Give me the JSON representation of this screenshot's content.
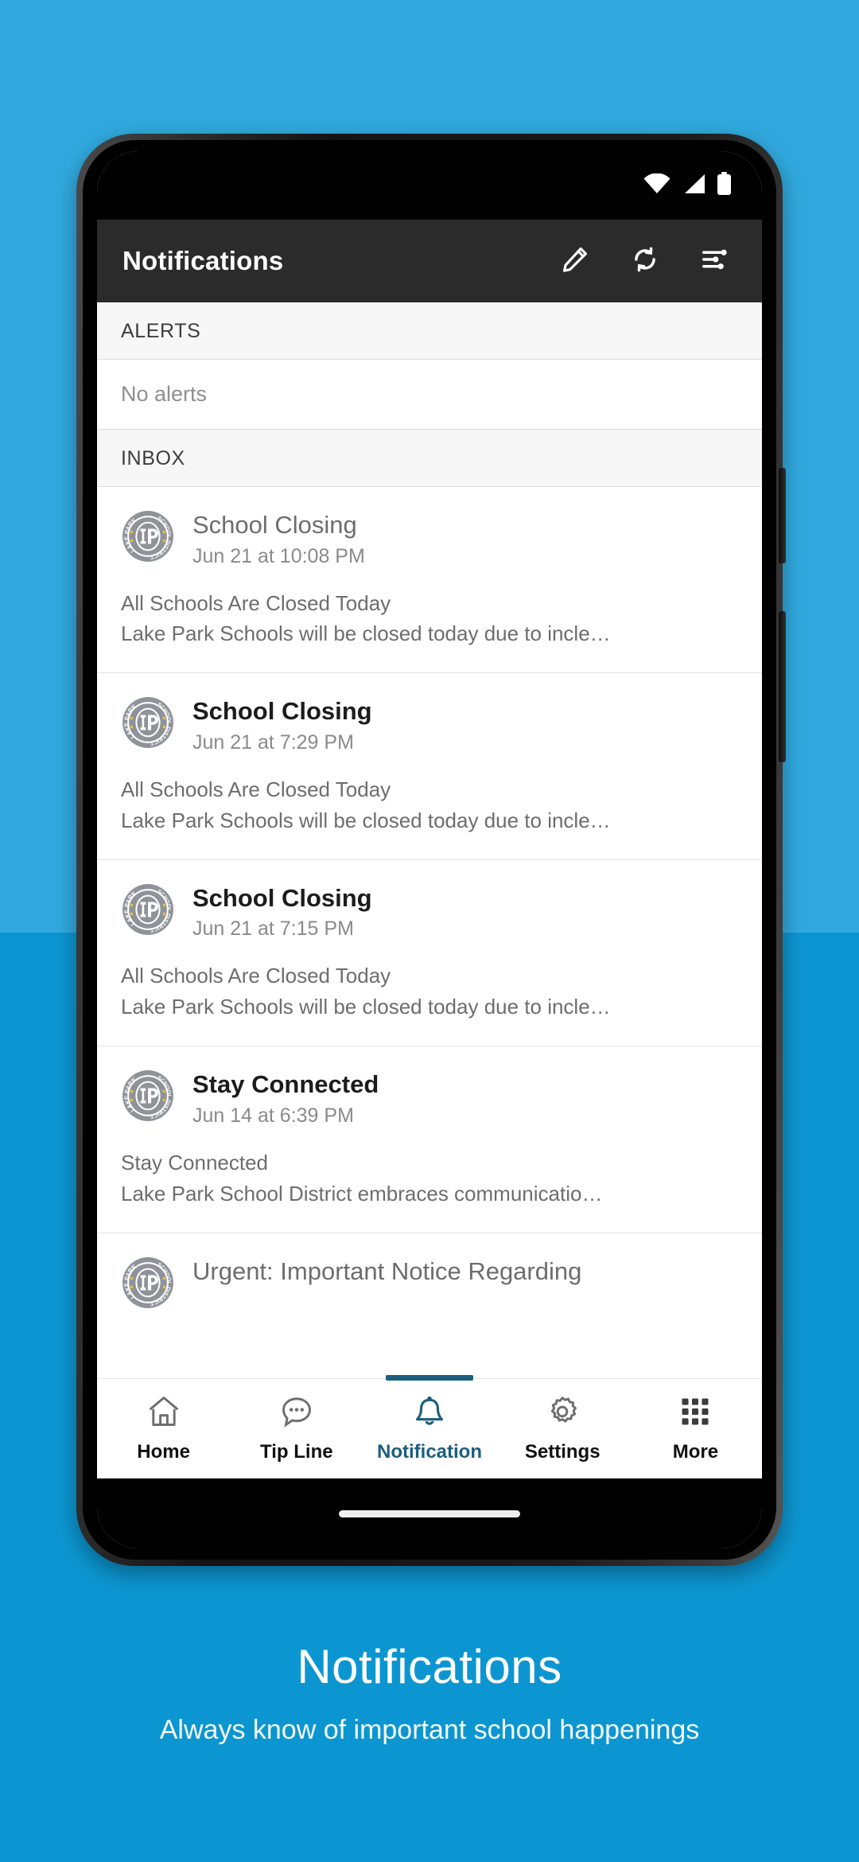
{
  "background": {
    "top_color": "#31a9de",
    "bottom_color": "#0c96d1"
  },
  "status_bar": {
    "icons": [
      "wifi-icon",
      "cellular-signal-icon",
      "battery-icon"
    ]
  },
  "app_bar": {
    "title": "Notifications",
    "actions": [
      {
        "name": "compose-button",
        "icon": "pencil-icon"
      },
      {
        "name": "refresh-button",
        "icon": "sync-icon"
      },
      {
        "name": "filter-button",
        "icon": "tune-sliders-icon"
      }
    ]
  },
  "sections": {
    "alerts_header": "ALERTS",
    "alerts_empty": "No alerts",
    "inbox_header": "INBOX"
  },
  "messages": [
    {
      "title": "School Closing",
      "date": "Jun 21 at 10:08 PM",
      "subject": "All Schools Are Closed Today",
      "preview": "Lake Park Schools will be closed today due to incle…",
      "unread": false,
      "logo": "lake-park-school-district-seal"
    },
    {
      "title": "School Closing",
      "date": "Jun 21 at 7:29 PM",
      "subject": "All Schools Are Closed Today",
      "preview": "Lake Park Schools will be closed today due to incle…",
      "unread": true,
      "logo": "lake-park-school-district-seal"
    },
    {
      "title": "School Closing",
      "date": "Jun 21 at 7:15 PM",
      "subject": "All Schools Are Closed Today",
      "preview": "Lake Park Schools will be closed today due to incle…",
      "unread": true,
      "logo": "lake-park-school-district-seal"
    },
    {
      "title": "Stay Connected",
      "date": "Jun 14 at 6:39 PM",
      "subject": "Stay Connected",
      "preview": "Lake Park School District embraces communicatio…",
      "unread": true,
      "logo": "lake-park-school-district-seal"
    },
    {
      "title": "Urgent: Important Notice Regarding",
      "date": "",
      "subject": "",
      "preview": "",
      "unread": false,
      "logo": "lake-park-school-district-seal"
    }
  ],
  "logo_text": {
    "top": "LAKE PARK",
    "bottom": "SCHOOL DISTRICT",
    "monogram": "LP"
  },
  "bottom_nav": {
    "active_color": "#1b5e7e",
    "items": [
      {
        "label": "Home",
        "icon": "home-icon",
        "active": false
      },
      {
        "label": "Tip Line",
        "icon": "chat-bubble-icon",
        "active": false
      },
      {
        "label": "Notification",
        "icon": "bell-icon",
        "active": true
      },
      {
        "label": "Settings",
        "icon": "gear-icon",
        "active": false
      },
      {
        "label": "More",
        "icon": "grid-apps-icon",
        "active": false
      }
    ]
  },
  "caption": {
    "title": "Notifications",
    "subtitle": "Always know of important school happenings"
  }
}
